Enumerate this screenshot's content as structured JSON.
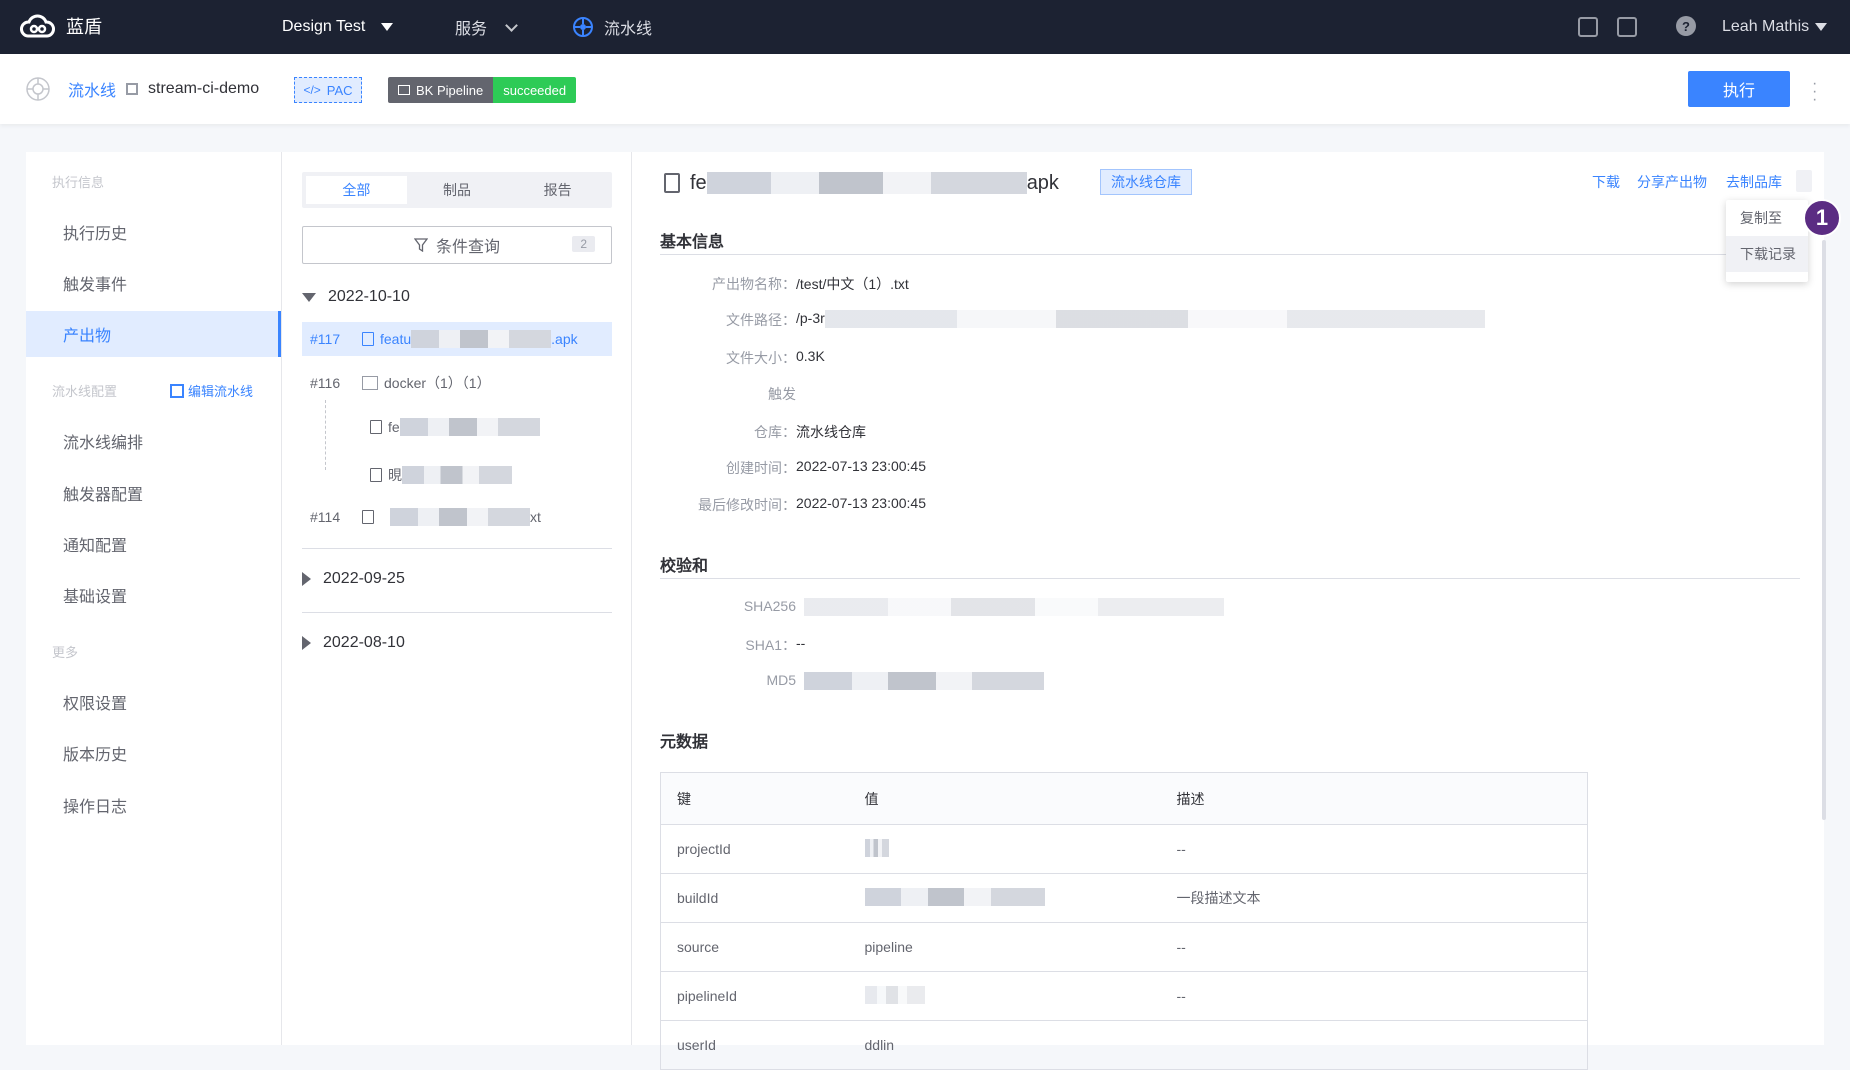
{
  "topnav": {
    "brand": "蓝盾",
    "project": "Design Test",
    "service": "服务",
    "pipeline": "流水线",
    "user": "Leah Mathis"
  },
  "subhead": {
    "crumb_pipeline": "流水线",
    "crumb_name": "stream-ci-demo",
    "pac_label": "PAC",
    "pipeline_tag": "BK Pipeline",
    "status": "succeeded",
    "execute": "执行"
  },
  "sidebar": {
    "group_exec": "执行信息",
    "group_config": "流水线配置",
    "edit_pipeline": "编辑流水线",
    "group_more": "更多",
    "items": [
      "执行历史",
      "触发事件",
      "产出物",
      "流水线编排",
      "触发器配置",
      "通知配置",
      "基础设置",
      "权限设置",
      "版本历史",
      "操作日志"
    ]
  },
  "middle": {
    "tabs": [
      "全部",
      "制品",
      "报告"
    ],
    "filter": "条件查询",
    "filter_count": "2",
    "dates": [
      "2022-10-10",
      "2022-09-25",
      "2022-08-10"
    ],
    "rows": {
      "r117_no": "#117",
      "r117_prefix": "featu",
      "r117_suffix": ".apk",
      "r116_no": "#116",
      "r116_name": "docker（1）（1）",
      "c1_prefix": "fe",
      "c2_prefix": "晛",
      "r114_no": "#114",
      "r114_suffix": "xt"
    }
  },
  "main": {
    "file_prefix": "fe",
    "file_suffix": "apk",
    "repo_tag": "流水线仓库",
    "link_download": "下载",
    "link_share": "分享产出物",
    "link_goto": "去制品库",
    "basic_title": "基本信息",
    "basic": {
      "name_k": "产出物名称：",
      "name_v": "/test/中文（1）.txt",
      "path_k": "文件路径：",
      "path_v": "/p-3r",
      "size_k": "文件大小：",
      "size_v": "0.3K",
      "trigger_k": "触发",
      "repo_k": "仓库：",
      "repo_v": "流水线仓库",
      "created_k": "创建时间：",
      "created_v": "2022-07-13  23:00:45",
      "modified_k": "最后修改时间：",
      "modified_v": "2022-07-13  23:00:45"
    },
    "checksum_title": "校验和",
    "checksum": {
      "sha256_k": "SHA256",
      "sha1_k": "SHA1：",
      "sha1_v": "--",
      "md5_k": "MD5"
    },
    "meta_title": "元数据",
    "meta_headers": [
      "键",
      "值",
      "描述"
    ],
    "meta_rows": [
      {
        "key": "projectId",
        "value": "",
        "desc": "--"
      },
      {
        "key": "buildId",
        "value": "",
        "desc": "一段描述文本"
      },
      {
        "key": "source",
        "value": "pipeline",
        "desc": "--"
      },
      {
        "key": "pipelineId",
        "value": "",
        "desc": "--"
      },
      {
        "key": "userId",
        "value": "ddlin",
        "desc": ""
      }
    ]
  },
  "dropdown": {
    "copy_to": "复制至",
    "download_log": "下载记录",
    "step": "1"
  }
}
